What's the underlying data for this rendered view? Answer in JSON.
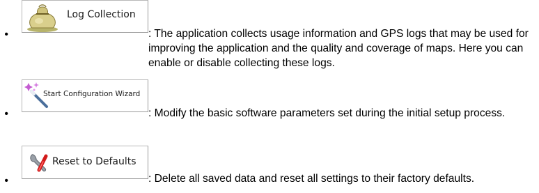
{
  "items": [
    {
      "icon": "money-bag-icon",
      "button_label": "Log Collection",
      "description": ": The application collects usage information and GPS logs that may be used for improving the application and the quality and coverage of maps. Here you can enable or disable collecting these logs."
    },
    {
      "icon": "magic-wand-icon",
      "button_label": "Start Configuration Wizard",
      "description": ": Modify the basic software parameters set during the initial setup process."
    },
    {
      "icon": "wrench-reset-icon",
      "button_label": "Reset to Defaults",
      "description": ": Delete all saved data and reset all settings to their factory defaults."
    }
  ]
}
